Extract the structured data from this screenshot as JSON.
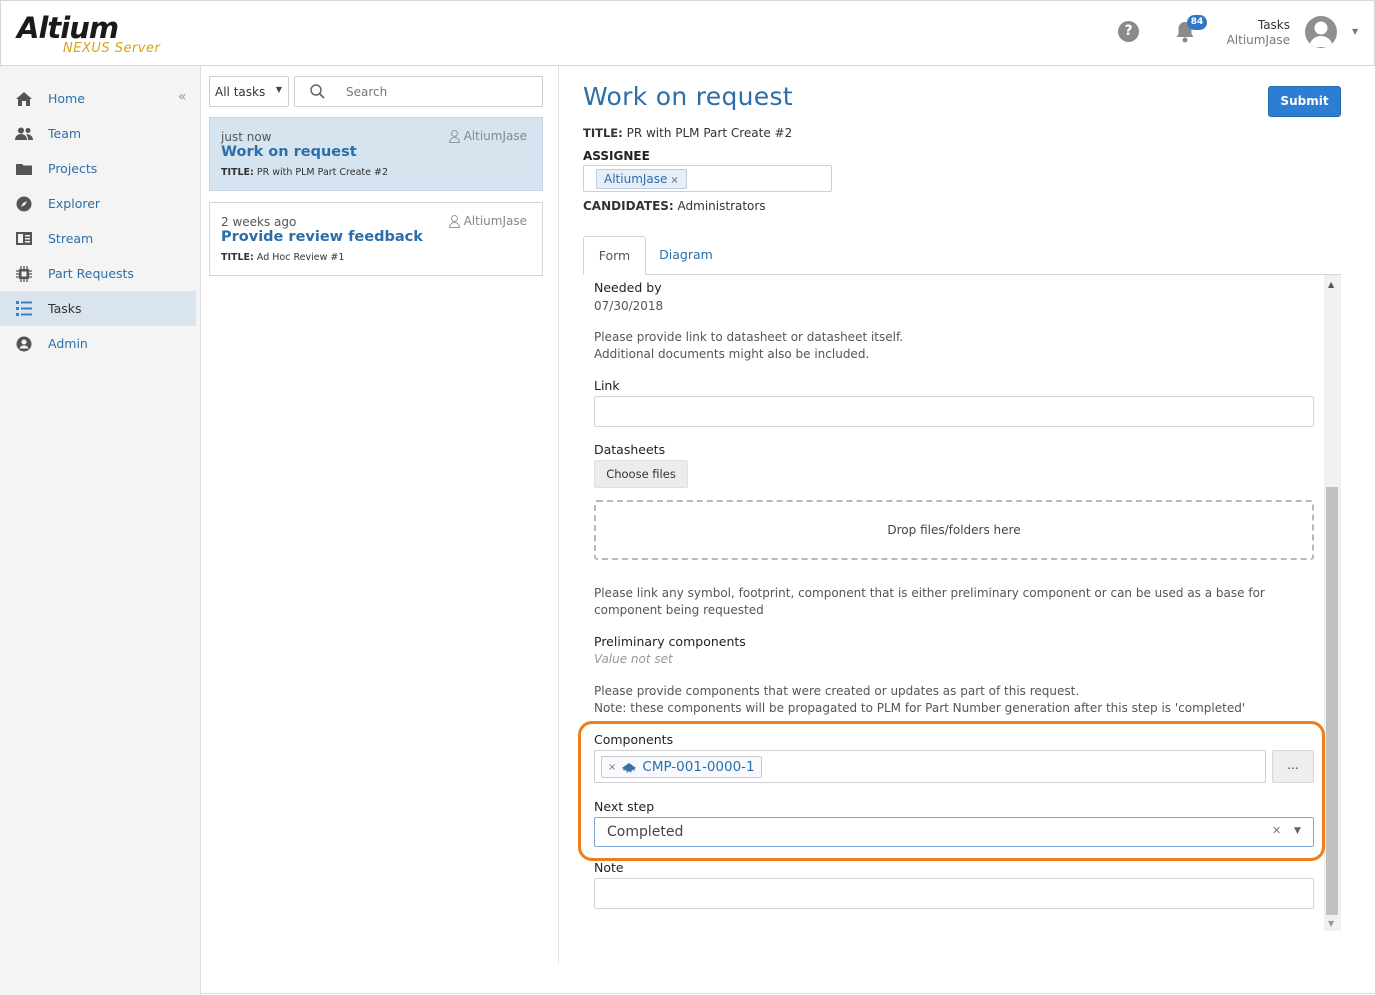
{
  "header": {
    "brand": "Altium",
    "brand_sub": "NEXUS Server",
    "notifications_count": "84",
    "user_line1": "Tasks",
    "user_line2": "AltiumJase"
  },
  "nav": {
    "items": [
      {
        "label": "Home",
        "icon": "home-icon"
      },
      {
        "label": "Team",
        "icon": "team-icon"
      },
      {
        "label": "Projects",
        "icon": "folder-icon"
      },
      {
        "label": "Explorer",
        "icon": "compass-icon"
      },
      {
        "label": "Stream",
        "icon": "stream-icon"
      },
      {
        "label": "Part Requests",
        "icon": "chip-icon"
      },
      {
        "label": "Tasks",
        "icon": "tasks-icon"
      },
      {
        "label": "Admin",
        "icon": "admin-icon"
      }
    ],
    "active": "Tasks"
  },
  "tasklist": {
    "filter_value": "All tasks",
    "search_placeholder": "Search",
    "cards": [
      {
        "time": "just now",
        "owner": "AltiumJase",
        "title": "Work on request",
        "sub_label": "TITLE:",
        "sub_value": "PR with PLM Part Create #2"
      },
      {
        "time": "2 weeks ago",
        "owner": "AltiumJase",
        "title": "Provide review feedback",
        "sub_label": "TITLE:",
        "sub_value": "Ad Hoc Review #1"
      }
    ]
  },
  "main": {
    "title": "Work on request",
    "submit_label": "Submit",
    "title_label": "TITLE:",
    "title_value": "PR with PLM Part Create #2",
    "assignee_label": "ASSIGNEE",
    "assignee_tag": "AltiumJase",
    "candidates_label": "CANDIDATES:",
    "candidates_value": "Administrators",
    "tabs": [
      "Form",
      "Diagram"
    ]
  },
  "form": {
    "needed_by_label": "Needed by",
    "needed_by_value": "07/30/2018",
    "info1_line1": "Please provide link to datasheet or datasheet itself.",
    "info1_line2": "Additional documents might also be included.",
    "link_label": "Link",
    "datasheets_label": "Datasheets",
    "choose_files": "Choose files",
    "drop_text": "Drop files/folders here",
    "info2": "Please link any symbol, footprint, component that is either preliminary component or can be used as a base for component being requested",
    "prelim_label": "Preliminary components",
    "prelim_value": "Value not set",
    "info3_line1": "Please provide components that were created or updates as part of this request.",
    "info3_line2": "Note: these components will be propagated to PLM for Part Number generation after this step is 'completed'",
    "components_label": "Components",
    "component_tag": "CMP-001-0000-1",
    "dots_label": "...",
    "next_step_label": "Next step",
    "next_step_value": "Completed",
    "note_label": "Note"
  },
  "colors": {
    "accent": "#2b6ea8",
    "submit": "#2d7dd2",
    "highlight": "#f07c1a",
    "logo_sub": "#d9a215"
  }
}
